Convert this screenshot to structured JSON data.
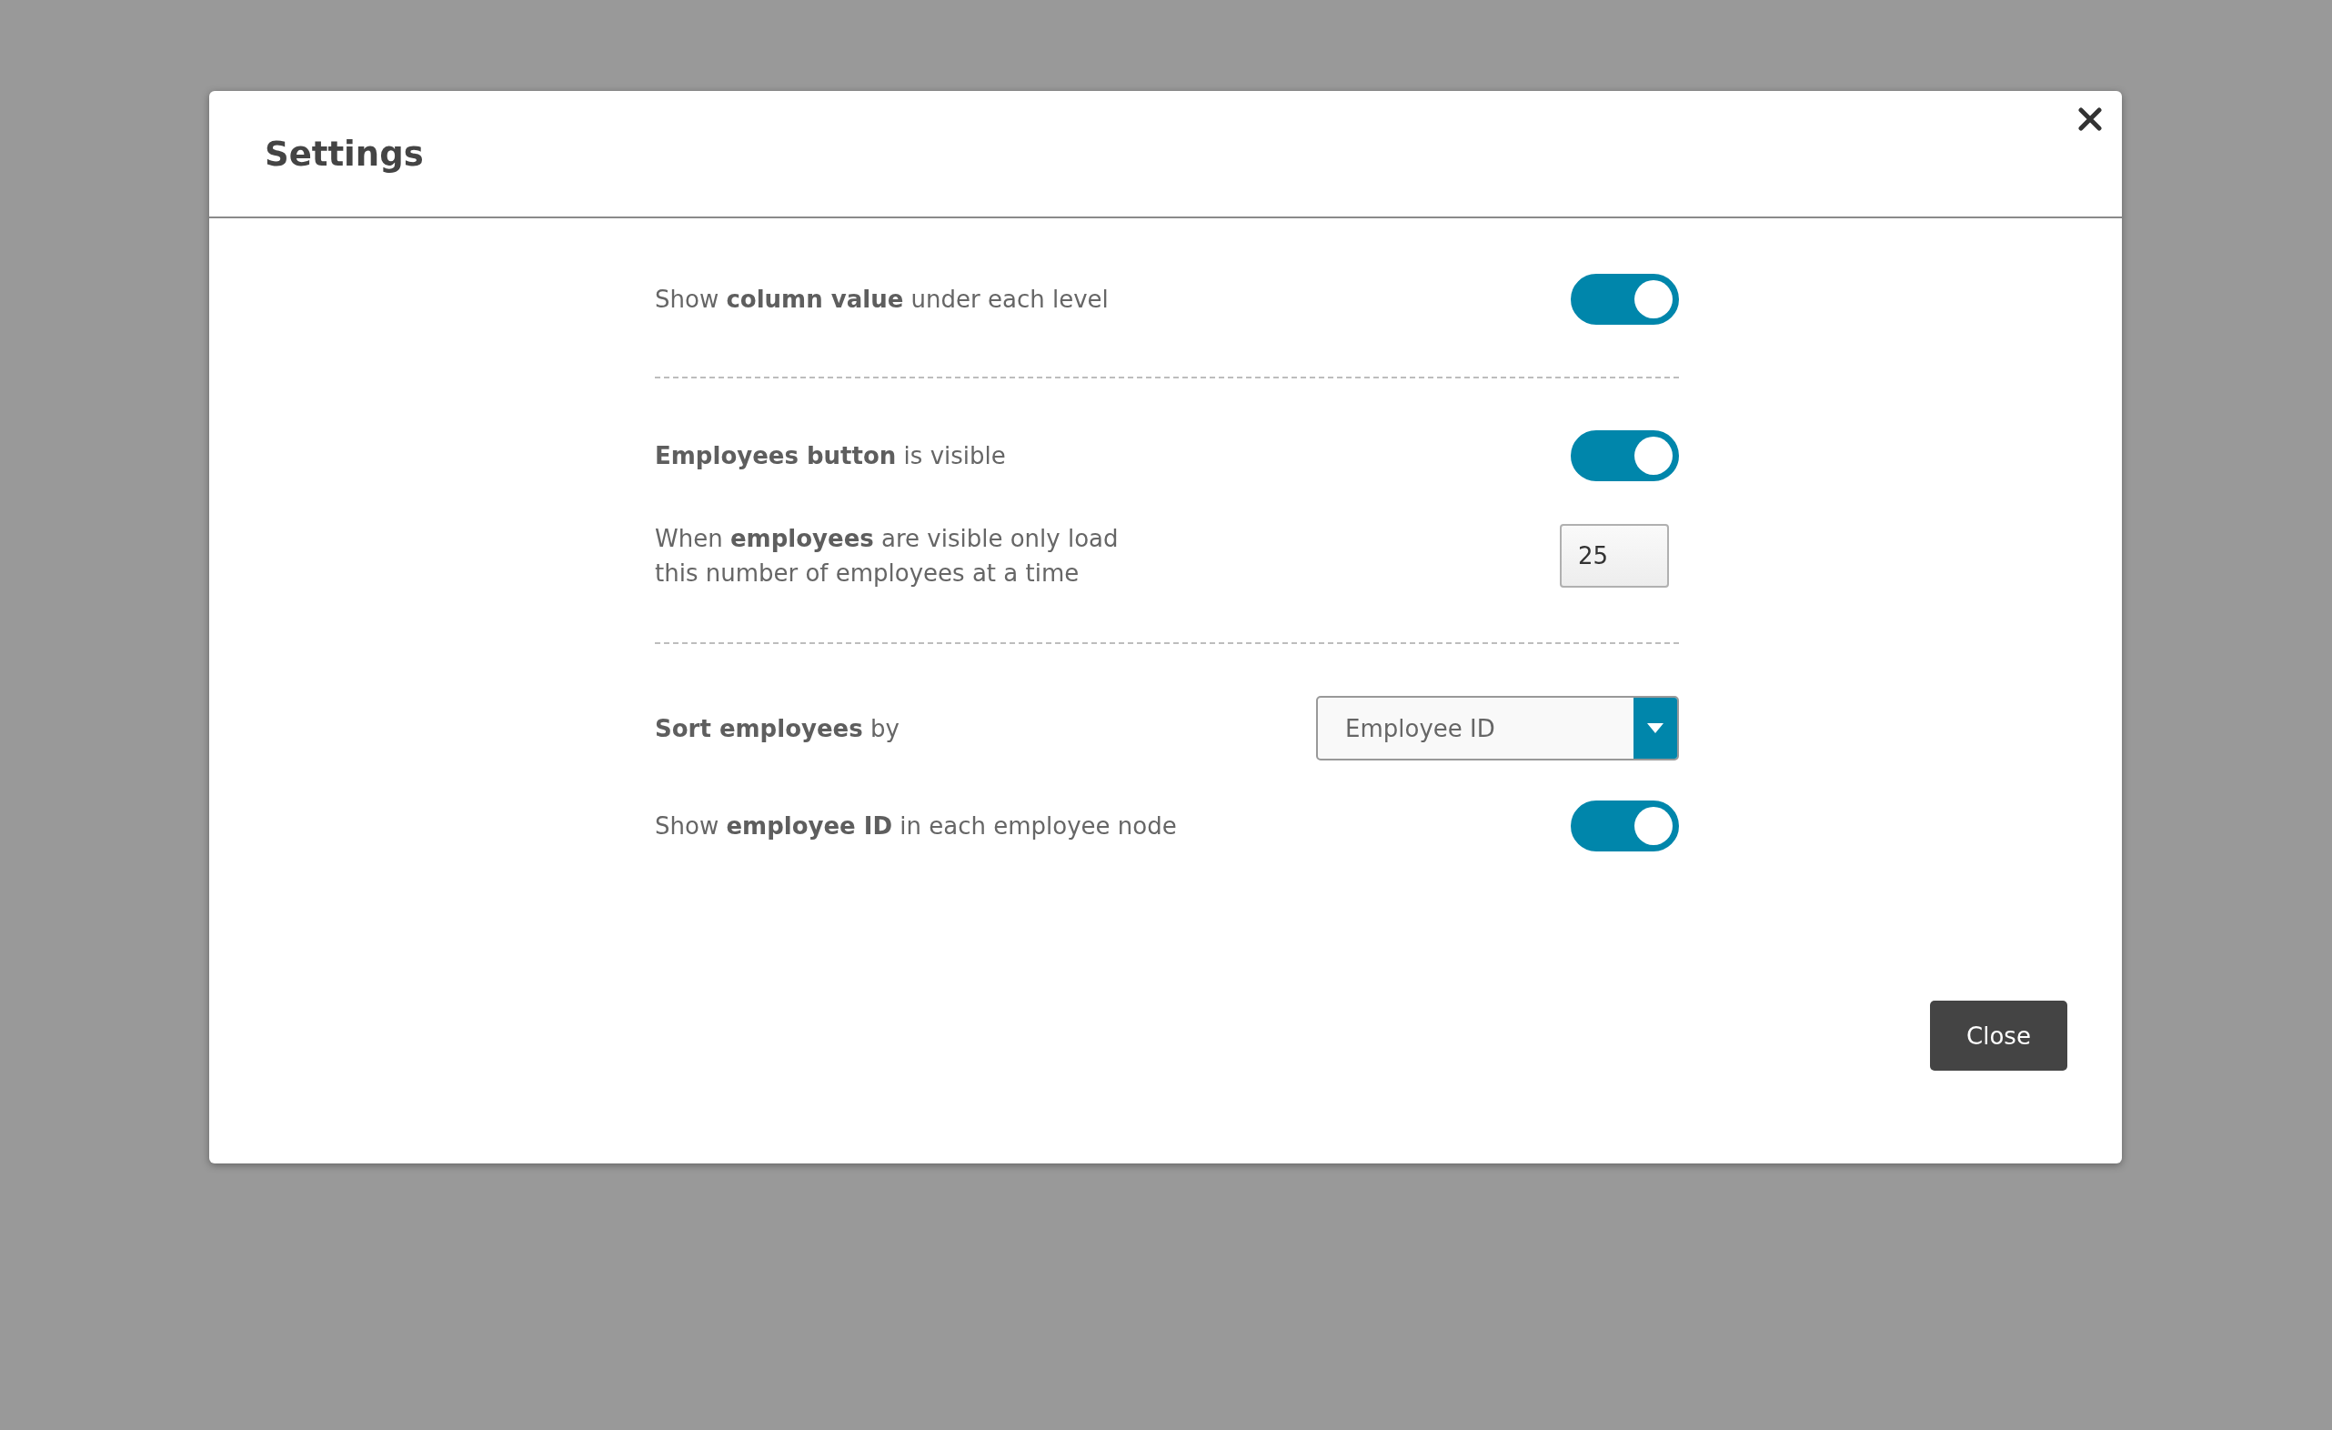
{
  "dialog": {
    "title": "Settings",
    "sections": [
      {
        "items": [
          {
            "kind": "toggle",
            "label": "Show **column value** under each level",
            "on": true
          }
        ]
      },
      {
        "items": [
          {
            "kind": "toggle",
            "label": "**Employees button** is visible",
            "on": true
          },
          {
            "kind": "number",
            "label": "When **employees** are visible only load\nthis number of employees at a time",
            "value": "25"
          }
        ]
      },
      {
        "items": [
          {
            "kind": "select",
            "label": "**Sort employees** by",
            "value": "Employee ID"
          },
          {
            "kind": "toggle",
            "label": "Show **employee ID** in each employee node",
            "on": true
          }
        ]
      }
    ],
    "buttons": [
      {
        "label": "Close"
      }
    ]
  }
}
